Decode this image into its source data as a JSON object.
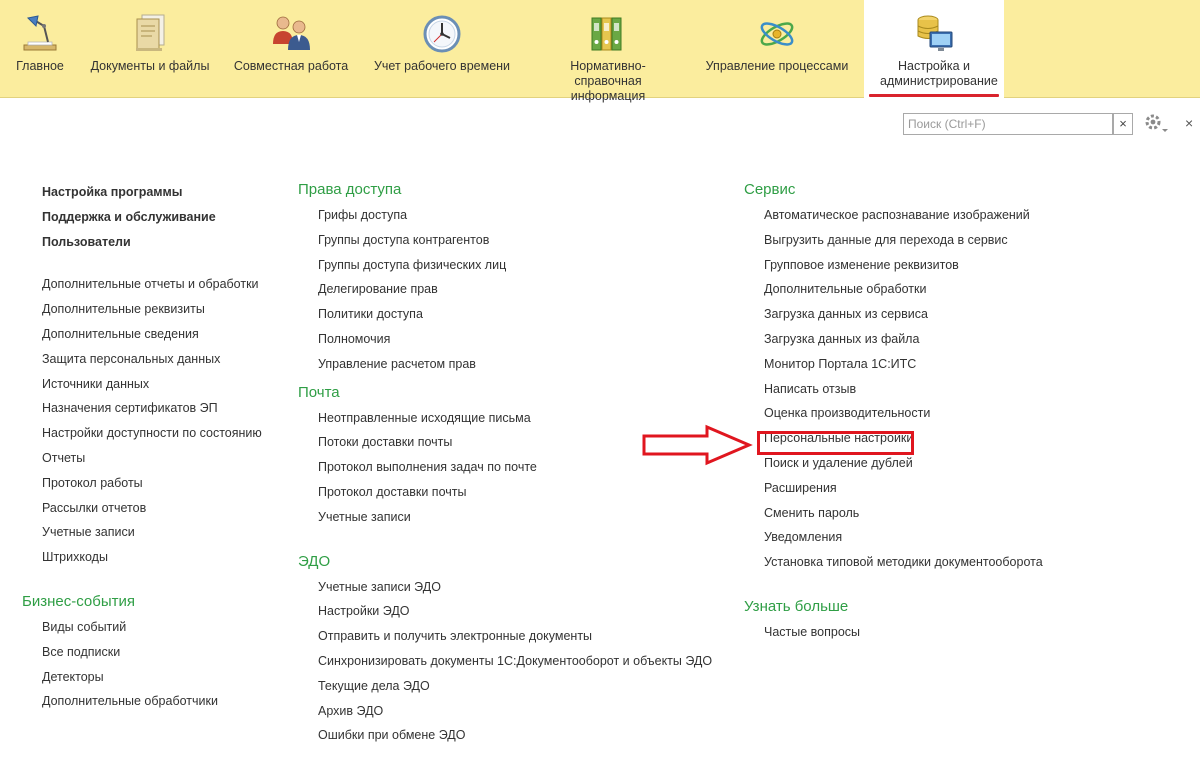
{
  "sections": [
    {
      "label": "Главное"
    },
    {
      "label": "Документы и файлы"
    },
    {
      "label": "Совместная работа"
    },
    {
      "label": "Учет рабочего времени"
    },
    {
      "label": "Нормативно-справочная информация"
    },
    {
      "label": "Управление процессами"
    },
    {
      "label": "Настройка и администрирование"
    }
  ],
  "search": {
    "placeholder": "Поиск (Ctrl+F)",
    "clear_label": "×",
    "close_label": "×"
  },
  "col1": {
    "bold_links": [
      "Настройка программы",
      "Поддержка и обслуживание",
      "Пользователи"
    ],
    "links": [
      "Дополнительные отчеты и обработки",
      "Дополнительные реквизиты",
      "Дополнительные сведения",
      "Защита персональных данных",
      "Источники данных",
      "Назначения сертификатов ЭП",
      "Настройки доступности по состоянию",
      "Отчеты",
      "Протокол работы",
      "Рассылки отчетов",
      "Учетные записи",
      "Штрихкоды"
    ],
    "business_title": "Бизнес-события",
    "business_links": [
      "Виды событий",
      "Все подписки",
      "Детекторы",
      "Дополнительные обработчики"
    ]
  },
  "col2": {
    "access_title": "Права доступа",
    "access_links": [
      "Грифы доступа",
      "Группы доступа контрагентов",
      "Группы доступа физических лиц",
      "Делегирование прав",
      "Политики доступа",
      "Полномочия",
      "Управление расчетом прав"
    ],
    "mail_title": "Почта",
    "mail_links": [
      "Неотправленные исходящие письма",
      "Потоки доставки почты",
      "Протокол выполнения задач по почте",
      "Протокол доставки почты",
      "Учетные записи"
    ],
    "edo_title": "ЭДО",
    "edo_links": [
      "Учетные записи ЭДО",
      "Настройки ЭДО",
      "Отправить и получить электронные документы",
      "Синхронизировать документы 1С:Документооборот и объекты ЭДО",
      "Текущие дела ЭДО",
      "Архив ЭДО",
      "Ошибки при обмене ЭДО"
    ]
  },
  "col3": {
    "service_title": "Сервис",
    "service_links": [
      "Автоматическое распознавание изображений",
      "Выгрузить данные для перехода в сервис",
      "Групповое изменение реквизитов",
      "Дополнительные обработки",
      "Загрузка данных из сервиса",
      "Загрузка данных из файла",
      "Монитор Портала 1С:ИТС",
      "Написать отзыв",
      "Оценка производительности",
      "Персональные настройки",
      "Поиск и удаление дублей",
      "Расширения",
      "Сменить пароль",
      "Уведомления",
      "Установка типовой методики документооборота"
    ],
    "more_title": "Узнать больше",
    "more_links": [
      "Частые вопросы"
    ]
  },
  "colors": {
    "panel": "#fbed9e",
    "accent_green": "#2f9e45",
    "highlight_red": "#e0161f"
  }
}
